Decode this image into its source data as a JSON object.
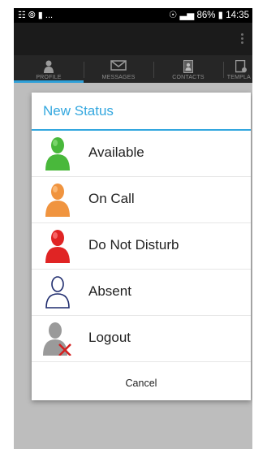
{
  "status_bar": {
    "left_icons": "☷ ⦾ ▮ ...",
    "battery": "86%",
    "time": "14:35"
  },
  "tabs": [
    {
      "label": "PROFILE",
      "icon": "person-icon"
    },
    {
      "label": "MESSAGES",
      "icon": "envelope-icon"
    },
    {
      "label": "CONTACTS",
      "icon": "contacts-icon"
    },
    {
      "label": "TEMPLA",
      "icon": "templates-icon"
    }
  ],
  "dialog": {
    "title": "New Status",
    "options": [
      {
        "label": "Available",
        "icon": "person-green-icon",
        "color": "#49b83b"
      },
      {
        "label": "On Call",
        "icon": "person-orange-icon",
        "color": "#f0943f"
      },
      {
        "label": "Do Not Disturb",
        "icon": "person-red-icon",
        "color": "#e02424"
      },
      {
        "label": "Absent",
        "icon": "person-outline-icon",
        "color": "#1f2c6e"
      },
      {
        "label": "Logout",
        "icon": "person-grey-x-icon",
        "color": "#9a9a9a"
      }
    ],
    "cancel_label": "Cancel"
  },
  "colors": {
    "accent": "#33a7df"
  }
}
